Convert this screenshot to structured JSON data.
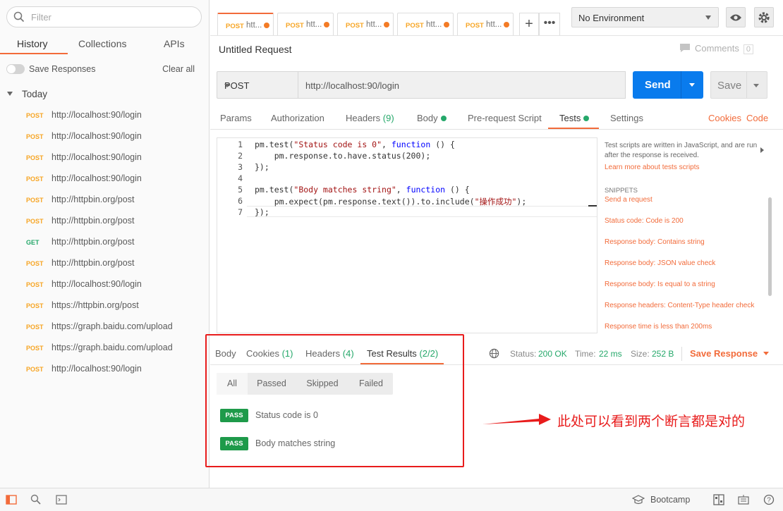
{
  "sidebar": {
    "filter_placeholder": "Filter",
    "tabs": [
      "History",
      "Collections",
      "APIs"
    ],
    "save_responses": "Save Responses",
    "clear_all": "Clear all",
    "group": "Today",
    "history": [
      {
        "method": "POST",
        "url": "http://localhost:90/login"
      },
      {
        "method": "POST",
        "url": "http://localhost:90/login"
      },
      {
        "method": "POST",
        "url": "http://localhost:90/login"
      },
      {
        "method": "POST",
        "url": "http://localhost:90/login"
      },
      {
        "method": "POST",
        "url": "http://httpbin.org/post"
      },
      {
        "method": "POST",
        "url": "http://httpbin.org/post"
      },
      {
        "method": "GET",
        "url": "http://httpbin.org/post"
      },
      {
        "method": "POST",
        "url": "http://httpbin.org/post"
      },
      {
        "method": "POST",
        "url": "http://localhost:90/login"
      },
      {
        "method": "POST",
        "url": "https://httpbin.org/post"
      },
      {
        "method": "POST",
        "url": "https://graph.baidu.com/upload"
      },
      {
        "method": "POST",
        "url": "https://graph.baidu.com/upload"
      },
      {
        "method": "POST",
        "url": "http://localhost:90/login"
      }
    ]
  },
  "tabs": [
    {
      "method": "POST",
      "title": "htt..."
    },
    {
      "method": "POST",
      "title": "htt..."
    },
    {
      "method": "POST",
      "title": "htt..."
    },
    {
      "method": "POST",
      "title": "htt..."
    },
    {
      "method": "POST",
      "title": "htt..."
    }
  ],
  "environment": "No Environment",
  "request": {
    "title": "Untitled Request",
    "comments": "Comments",
    "comments_count": "0",
    "method": "POST",
    "url": "http://localhost:90/login",
    "send": "Send",
    "save": "Save"
  },
  "request_tabs": {
    "params": "Params",
    "authorization": "Authorization",
    "headers": "Headers",
    "headers_count": "(9)",
    "body": "Body",
    "pre_request": "Pre-request Script",
    "tests": "Tests",
    "settings": "Settings",
    "cookies": "Cookies",
    "code": "Code"
  },
  "editor": {
    "line_numbers": [
      "1",
      "2",
      "3",
      "4",
      "5",
      "6",
      "7"
    ]
  },
  "snippets": {
    "description": "Test scripts are written in JavaScript, and are run after the response is received.",
    "learn_more": "Learn more about tests scripts",
    "heading": "SNIPPETS",
    "items": [
      "Send a request",
      "Status code: Code is 200",
      "Response body: Contains string",
      "Response body: JSON value check",
      "Response body: Is equal to a string",
      "Response headers: Content-Type header check",
      "Response time is less than 200ms"
    ]
  },
  "response": {
    "tabs": {
      "body": "Body",
      "cookies": "Cookies",
      "cookies_count": "(1)",
      "headers": "Headers",
      "headers_count": "(4)",
      "test_results": "Test Results",
      "test_results_count": "(2/2)"
    },
    "status_label": "Status:",
    "status_value": "200 OK",
    "time_label": "Time:",
    "time_value": "22 ms",
    "size_label": "Size:",
    "size_value": "252 B",
    "save_response": "Save Response",
    "filters": [
      "All",
      "Passed",
      "Skipped",
      "Failed"
    ],
    "results": [
      {
        "badge": "PASS",
        "name": "Status code is 0"
      },
      {
        "badge": "PASS",
        "name": "Body matches string"
      }
    ]
  },
  "annotation": "此处可以看到两个断言都是对的",
  "statusbar": {
    "bootcamp": "Bootcamp"
  },
  "colors": {
    "accent": "#f26b3a",
    "send": "#097bed",
    "pass": "#1e9a4a",
    "annotation": "#e81c1c"
  }
}
